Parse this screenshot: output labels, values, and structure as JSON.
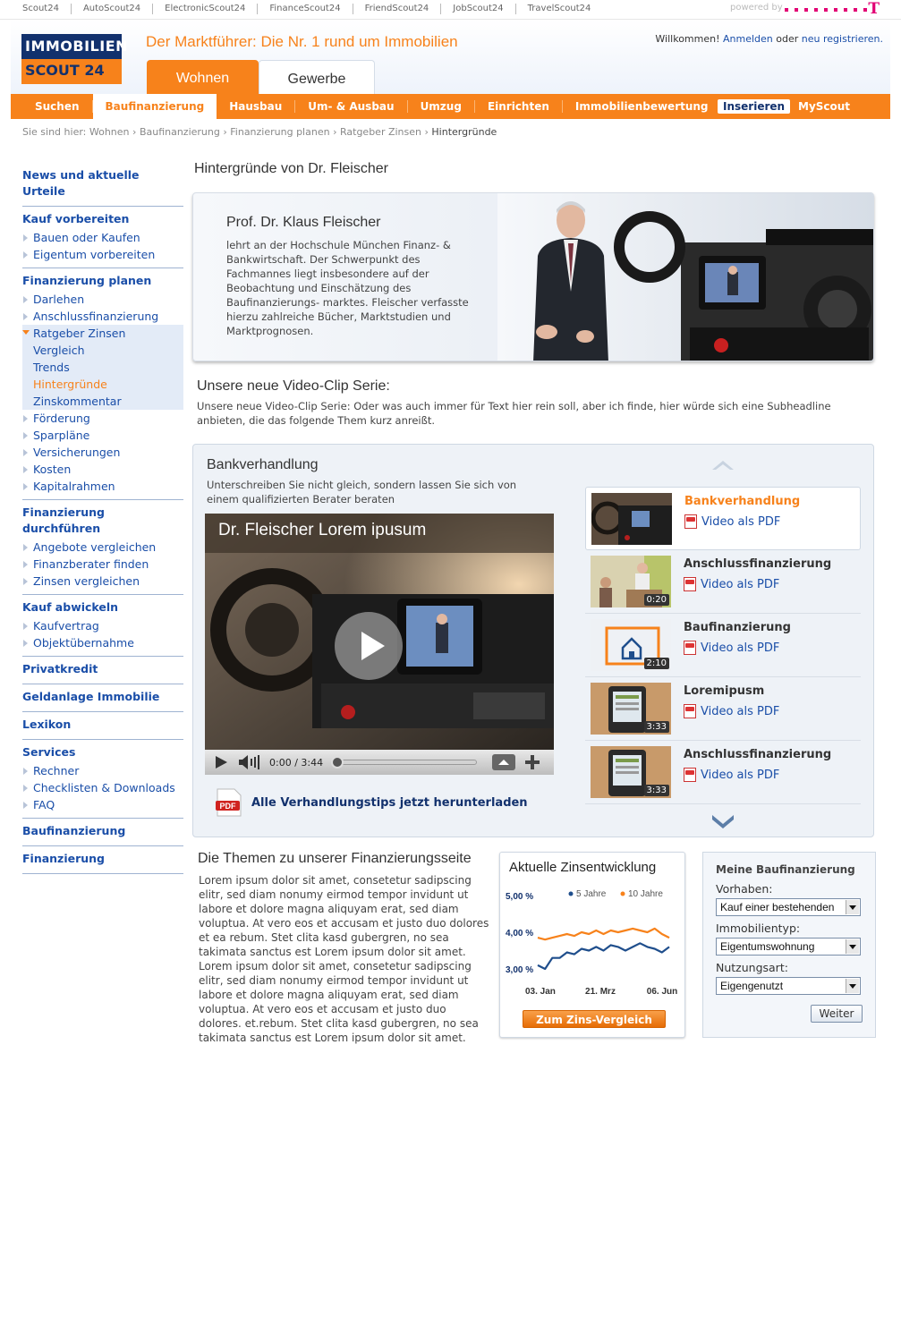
{
  "topbar": {
    "links": [
      "Scout24",
      "AutoScout24",
      "ElectronicScout24",
      "FinanceScout24",
      "FriendScout24",
      "JobScout24",
      "TravelScout24"
    ],
    "powered_by": "powered by"
  },
  "header": {
    "logo_line1": "IMMOBILIEN",
    "logo_line2": "SCOUT 24",
    "tagline": "Der Marktführer: Die Nr. 1 rund um Immobilien",
    "welcome": "Willkommen!",
    "login": "Anmelden",
    "or": "oder",
    "register": "neu registrieren.",
    "tabs": [
      "Wohnen",
      "Gewerbe"
    ]
  },
  "nav": {
    "items": [
      "Suchen",
      "Baufinanzierung",
      "Hausbau",
      "Um- & Ausbau",
      "Umzug",
      "Einrichten",
      "Immobilienbewertung"
    ],
    "inserieren": "Inserieren",
    "myscout": "MyScout"
  },
  "breadcrumb": {
    "prefix": "Sie sind hier:",
    "items": [
      "Wohnen",
      "Baufinanzierung",
      "Finanzierung planen",
      "Ratgeber Zinsen"
    ],
    "current": "Hintergründe"
  },
  "sidebar": {
    "g1": "News und aktuelle Urteile",
    "g2": "Kauf vorbereiten",
    "g2_items": [
      "Bauen oder Kaufen",
      "Eigentum vorbereiten"
    ],
    "g3": "Finanzierung planen",
    "g3_items": [
      "Darlehen",
      "Anschlussfinanzierung",
      "Ratgeber Zinsen",
      "Vergleich",
      "Trends",
      "Hintergründe",
      "Zinskommentar",
      "Förderung",
      "Sparpläne",
      "Versicherungen",
      "Kosten",
      "Kapitalrahmen"
    ],
    "g4": "Finanzierung durchführen",
    "g4_items": [
      "Angebote vergleichen",
      "Finanzberater finden",
      "Zinsen vergleichen"
    ],
    "g5": "Kauf abwickeln",
    "g5_items": [
      "Kaufvertrag",
      "Objektübernahme"
    ],
    "g6": "Privatkredit",
    "g7": "Geldanlage Immobilie",
    "g8": "Lexikon",
    "g9": "Services",
    "g9_items": [
      "Rechner",
      "Checklisten & Downloads",
      "FAQ"
    ],
    "g10": "Baufinanzierung",
    "g11": "Finanzierung"
  },
  "content": {
    "title": "Hintergründe von Dr. Fleischer",
    "hero_name": "Prof. Dr. Klaus Fleischer",
    "hero_bio": "lehrt an der Hochschule München Finanz- & Bankwirtschaft. Der Schwerpunkt des Fachmannes liegt insbesondere auf der Beobachtung und Einschätzung des Baufinanzierungs- marktes. Fleischer verfasste hierzu zahlreiche Bücher, Marktstudien und Marktprognosen.",
    "series_title": "Unsere neue Video-Clip Serie:",
    "series_text": "Unsere neue Video-Clip Serie: Oder was auch immer für Text hier rein soll, aber ich finde, hier würde sich eine Subheadline anbieten, die das folgende Them kurz anreißt."
  },
  "video": {
    "title": "Bankverhandlung",
    "subtitle": "Unterschreiben Sie nicht gleich, sondern lassen Sie sich von einem qualifizierten Berater beraten",
    "player_title": "Dr. Fleischer Lorem ipusum",
    "time": "0:00 / 3:44",
    "download": "Alle Verhandlungstips jetzt herunterladen",
    "pdf_label": "PDF",
    "clips": [
      {
        "title": "Bankverhandlung",
        "link": "Video als PDF",
        "duration": ""
      },
      {
        "title": "Anschlussfinanzierung",
        "link": "Video als PDF",
        "duration": "0:20"
      },
      {
        "title": "Baufinanzierung",
        "link": "Video als PDF",
        "duration": "2:10"
      },
      {
        "title": "Loremipusm",
        "link": "Video als PDF",
        "duration": "3:33"
      },
      {
        "title": "Anschlussfinanzierung",
        "link": "Video als PDF",
        "duration": "3:33"
      }
    ]
  },
  "themes": {
    "title": "Die Themen zu unserer Finanzierungsseite",
    "text": "Lorem ipsum dolor sit amet, consetetur sadipscing elitr, sed diam nonumy eirmod tempor invidunt ut labore et dolore magna aliquyam erat, sed diam voluptua. At vero eos et accusam et justo duo dolores et ea rebum. Stet clita kasd gubergren, no sea takimata sanctus est Lorem ipsum dolor sit amet. Lorem ipsum dolor sit amet, consetetur sadipscing elitr, sed diam nonumy eirmod tempor invidunt ut labore et dolore magna aliquyam erat, sed diam voluptua. At vero eos et accusam et justo duo dolores. et.rebum. Stet clita kasd gubergren, no sea takimata sanctus est Lorem ipsum dolor sit amet."
  },
  "zins": {
    "title": "Aktuelle Zinsentwicklung",
    "button": "Zum Zins-Vergleich",
    "colors": {
      "5_jahre": "#1f4e8c",
      "10_jahre": "#f7821b"
    }
  },
  "chart_data": {
    "type": "line",
    "title": "Aktuelle Zinsentwicklung",
    "x_ticks": [
      "03. Jan",
      "21. Mrz",
      "06. Jun"
    ],
    "y_ticks": [
      "5,00 %",
      "4,00 %",
      "3,00 %"
    ],
    "ylim": [
      3.0,
      5.0
    ],
    "series": [
      {
        "name": "5 Jahre",
        "values": [
          3.1,
          3.0,
          3.3,
          3.3,
          3.45,
          3.4,
          3.55,
          3.5,
          3.6,
          3.5,
          3.65,
          3.6,
          3.5,
          3.6,
          3.7,
          3.6,
          3.55,
          3.45,
          3.6
        ]
      },
      {
        "name": "10 Jahre",
        "values": [
          3.85,
          3.8,
          3.85,
          3.9,
          3.95,
          3.9,
          4.0,
          3.95,
          4.05,
          3.95,
          4.05,
          4.0,
          4.05,
          4.1,
          4.05,
          4.0,
          4.1,
          3.95,
          3.85
        ]
      }
    ]
  },
  "baufi": {
    "title": "Meine Baufinanzierung",
    "vorhaben_label": "Vorhaben:",
    "vorhaben_value": "Kauf einer bestehenden",
    "typ_label": "Immobilientyp:",
    "typ_value": "Eigentumswohnung",
    "nutzung_label": "Nutzungsart:",
    "nutzung_value": "Eigengenutzt",
    "button": "Weiter"
  }
}
